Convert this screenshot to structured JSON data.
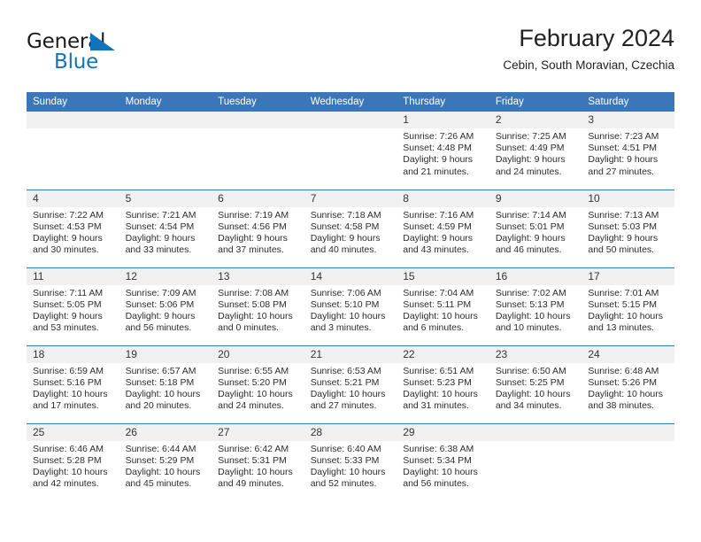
{
  "brand": {
    "line1": "General",
    "line2": "Blue",
    "triangle_icon": "triangle-icon",
    "colors": {
      "blue": "#1273ba",
      "dark": "#1b1b1b"
    }
  },
  "header": {
    "title": "February 2024",
    "location": "Cebin, South Moravian, Czechia"
  },
  "theme": {
    "header_blue": "#3b76b8",
    "daynum_band": "#f0f0f0"
  },
  "weekday_headers": [
    "Sunday",
    "Monday",
    "Tuesday",
    "Wednesday",
    "Thursday",
    "Friday",
    "Saturday"
  ],
  "labels": {
    "sunrise_prefix": "Sunrise:",
    "sunset_prefix": "Sunset:",
    "daylight_prefix": "Daylight:"
  },
  "weeks": [
    [
      {
        "day": "",
        "sunrise": "",
        "sunset": "",
        "daylight_line1": "",
        "daylight_line2": ""
      },
      {
        "day": "",
        "sunrise": "",
        "sunset": "",
        "daylight_line1": "",
        "daylight_line2": ""
      },
      {
        "day": "",
        "sunrise": "",
        "sunset": "",
        "daylight_line1": "",
        "daylight_line2": ""
      },
      {
        "day": "",
        "sunrise": "",
        "sunset": "",
        "daylight_line1": "",
        "daylight_line2": ""
      },
      {
        "day": "1",
        "sunrise": "Sunrise: 7:26 AM",
        "sunset": "Sunset: 4:48 PM",
        "daylight_line1": "Daylight: 9 hours",
        "daylight_line2": "and 21 minutes."
      },
      {
        "day": "2",
        "sunrise": "Sunrise: 7:25 AM",
        "sunset": "Sunset: 4:49 PM",
        "daylight_line1": "Daylight: 9 hours",
        "daylight_line2": "and 24 minutes."
      },
      {
        "day": "3",
        "sunrise": "Sunrise: 7:23 AM",
        "sunset": "Sunset: 4:51 PM",
        "daylight_line1": "Daylight: 9 hours",
        "daylight_line2": "and 27 minutes."
      }
    ],
    [
      {
        "day": "4",
        "sunrise": "Sunrise: 7:22 AM",
        "sunset": "Sunset: 4:53 PM",
        "daylight_line1": "Daylight: 9 hours",
        "daylight_line2": "and 30 minutes."
      },
      {
        "day": "5",
        "sunrise": "Sunrise: 7:21 AM",
        "sunset": "Sunset: 4:54 PM",
        "daylight_line1": "Daylight: 9 hours",
        "daylight_line2": "and 33 minutes."
      },
      {
        "day": "6",
        "sunrise": "Sunrise: 7:19 AM",
        "sunset": "Sunset: 4:56 PM",
        "daylight_line1": "Daylight: 9 hours",
        "daylight_line2": "and 37 minutes."
      },
      {
        "day": "7",
        "sunrise": "Sunrise: 7:18 AM",
        "sunset": "Sunset: 4:58 PM",
        "daylight_line1": "Daylight: 9 hours",
        "daylight_line2": "and 40 minutes."
      },
      {
        "day": "8",
        "sunrise": "Sunrise: 7:16 AM",
        "sunset": "Sunset: 4:59 PM",
        "daylight_line1": "Daylight: 9 hours",
        "daylight_line2": "and 43 minutes."
      },
      {
        "day": "9",
        "sunrise": "Sunrise: 7:14 AM",
        "sunset": "Sunset: 5:01 PM",
        "daylight_line1": "Daylight: 9 hours",
        "daylight_line2": "and 46 minutes."
      },
      {
        "day": "10",
        "sunrise": "Sunrise: 7:13 AM",
        "sunset": "Sunset: 5:03 PM",
        "daylight_line1": "Daylight: 9 hours",
        "daylight_line2": "and 50 minutes."
      }
    ],
    [
      {
        "day": "11",
        "sunrise": "Sunrise: 7:11 AM",
        "sunset": "Sunset: 5:05 PM",
        "daylight_line1": "Daylight: 9 hours",
        "daylight_line2": "and 53 minutes."
      },
      {
        "day": "12",
        "sunrise": "Sunrise: 7:09 AM",
        "sunset": "Sunset: 5:06 PM",
        "daylight_line1": "Daylight: 9 hours",
        "daylight_line2": "and 56 minutes."
      },
      {
        "day": "13",
        "sunrise": "Sunrise: 7:08 AM",
        "sunset": "Sunset: 5:08 PM",
        "daylight_line1": "Daylight: 10 hours",
        "daylight_line2": "and 0 minutes."
      },
      {
        "day": "14",
        "sunrise": "Sunrise: 7:06 AM",
        "sunset": "Sunset: 5:10 PM",
        "daylight_line1": "Daylight: 10 hours",
        "daylight_line2": "and 3 minutes."
      },
      {
        "day": "15",
        "sunrise": "Sunrise: 7:04 AM",
        "sunset": "Sunset: 5:11 PM",
        "daylight_line1": "Daylight: 10 hours",
        "daylight_line2": "and 6 minutes."
      },
      {
        "day": "16",
        "sunrise": "Sunrise: 7:02 AM",
        "sunset": "Sunset: 5:13 PM",
        "daylight_line1": "Daylight: 10 hours",
        "daylight_line2": "and 10 minutes."
      },
      {
        "day": "17",
        "sunrise": "Sunrise: 7:01 AM",
        "sunset": "Sunset: 5:15 PM",
        "daylight_line1": "Daylight: 10 hours",
        "daylight_line2": "and 13 minutes."
      }
    ],
    [
      {
        "day": "18",
        "sunrise": "Sunrise: 6:59 AM",
        "sunset": "Sunset: 5:16 PM",
        "daylight_line1": "Daylight: 10 hours",
        "daylight_line2": "and 17 minutes."
      },
      {
        "day": "19",
        "sunrise": "Sunrise: 6:57 AM",
        "sunset": "Sunset: 5:18 PM",
        "daylight_line1": "Daylight: 10 hours",
        "daylight_line2": "and 20 minutes."
      },
      {
        "day": "20",
        "sunrise": "Sunrise: 6:55 AM",
        "sunset": "Sunset: 5:20 PM",
        "daylight_line1": "Daylight: 10 hours",
        "daylight_line2": "and 24 minutes."
      },
      {
        "day": "21",
        "sunrise": "Sunrise: 6:53 AM",
        "sunset": "Sunset: 5:21 PM",
        "daylight_line1": "Daylight: 10 hours",
        "daylight_line2": "and 27 minutes."
      },
      {
        "day": "22",
        "sunrise": "Sunrise: 6:51 AM",
        "sunset": "Sunset: 5:23 PM",
        "daylight_line1": "Daylight: 10 hours",
        "daylight_line2": "and 31 minutes."
      },
      {
        "day": "23",
        "sunrise": "Sunrise: 6:50 AM",
        "sunset": "Sunset: 5:25 PM",
        "daylight_line1": "Daylight: 10 hours",
        "daylight_line2": "and 34 minutes."
      },
      {
        "day": "24",
        "sunrise": "Sunrise: 6:48 AM",
        "sunset": "Sunset: 5:26 PM",
        "daylight_line1": "Daylight: 10 hours",
        "daylight_line2": "and 38 minutes."
      }
    ],
    [
      {
        "day": "25",
        "sunrise": "Sunrise: 6:46 AM",
        "sunset": "Sunset: 5:28 PM",
        "daylight_line1": "Daylight: 10 hours",
        "daylight_line2": "and 42 minutes."
      },
      {
        "day": "26",
        "sunrise": "Sunrise: 6:44 AM",
        "sunset": "Sunset: 5:29 PM",
        "daylight_line1": "Daylight: 10 hours",
        "daylight_line2": "and 45 minutes."
      },
      {
        "day": "27",
        "sunrise": "Sunrise: 6:42 AM",
        "sunset": "Sunset: 5:31 PM",
        "daylight_line1": "Daylight: 10 hours",
        "daylight_line2": "and 49 minutes."
      },
      {
        "day": "28",
        "sunrise": "Sunrise: 6:40 AM",
        "sunset": "Sunset: 5:33 PM",
        "daylight_line1": "Daylight: 10 hours",
        "daylight_line2": "and 52 minutes."
      },
      {
        "day": "29",
        "sunrise": "Sunrise: 6:38 AM",
        "sunset": "Sunset: 5:34 PM",
        "daylight_line1": "Daylight: 10 hours",
        "daylight_line2": "and 56 minutes."
      },
      {
        "day": "",
        "sunrise": "",
        "sunset": "",
        "daylight_line1": "",
        "daylight_line2": ""
      },
      {
        "day": "",
        "sunrise": "",
        "sunset": "",
        "daylight_line1": "",
        "daylight_line2": ""
      }
    ]
  ]
}
